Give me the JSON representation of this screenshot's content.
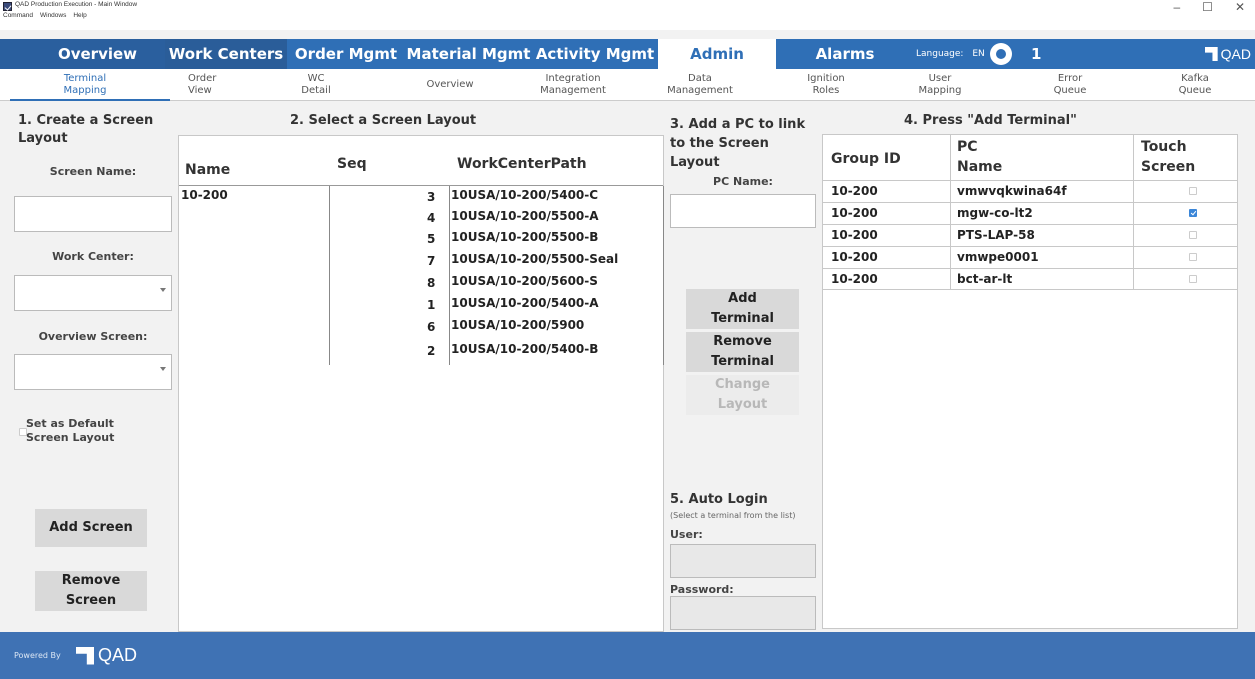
{
  "window": {
    "title": "QAD Production Execution - Main Window",
    "menu": [
      "Command",
      "Windows",
      "Help"
    ],
    "controls": [
      "–",
      "☐",
      "✕"
    ]
  },
  "topnav": {
    "tabs": [
      "Overview",
      "Work Centers",
      "Order Mgmt",
      "Material Mgmt",
      "Activity Mgmt",
      "Admin",
      "Alarms"
    ],
    "active": "Admin",
    "language_label": "Language:",
    "language_value": "EN",
    "alarm_count": "1",
    "logo": "QAD"
  },
  "subnav": {
    "items": [
      {
        "line1": "Terminal",
        "line2": "Mapping"
      },
      {
        "line1": "Order",
        "line2": "View"
      },
      {
        "line1": "WC",
        "line2": "Detail"
      },
      {
        "line1": "Overview",
        "line2": ""
      },
      {
        "line1": "Integration",
        "line2": "Management"
      },
      {
        "line1": "Data",
        "line2": "Management"
      },
      {
        "line1": "Ignition",
        "line2": "Roles"
      },
      {
        "line1": "User",
        "line2": "Mapping"
      },
      {
        "line1": "Error",
        "line2": "Queue"
      },
      {
        "line1": "Kafka",
        "line2": "Queue"
      }
    ],
    "active_index": 0
  },
  "section1": {
    "heading_line1": "1. Create a Screen",
    "heading_line2": "Layout",
    "screen_name_label": "Screen Name:",
    "screen_name_value": "",
    "work_center_label": "Work Center:",
    "work_center_value": "",
    "overview_screen_label": "Overview Screen:",
    "overview_screen_value": "",
    "default_label_line1": "Set as Default",
    "default_label_line2": "Screen Layout",
    "default_checked": false,
    "add_button": "Add Screen",
    "remove_button_line1": "Remove",
    "remove_button_line2": "Screen"
  },
  "section2": {
    "heading": "2. Select a Screen Layout",
    "columns": [
      "Name",
      "Seq",
      "WorkCenterPath"
    ],
    "name": "10-200",
    "rows": [
      {
        "seq": "3",
        "path": "10USA/10-200/5400-C"
      },
      {
        "seq": "4",
        "path": "10USA/10-200/5500-A"
      },
      {
        "seq": "5",
        "path": "10USA/10-200/5500-B"
      },
      {
        "seq": "7",
        "path": "10USA/10-200/5500-Seal"
      },
      {
        "seq": "8",
        "path": "10USA/10-200/5600-S"
      },
      {
        "seq": "1",
        "path": "10USA/10-200/5400-A"
      },
      {
        "seq": "6",
        "path": "10USA/10-200/5900"
      },
      {
        "seq": "2",
        "path": "10USA/10-200/5400-B"
      }
    ]
  },
  "section3": {
    "heading_line1": "3. Add a PC to link",
    "heading_line2": "to the Screen",
    "heading_line3": "Layout",
    "pc_name_label": "PC Name:",
    "pc_name_value": "",
    "add_terminal_line1": "Add",
    "add_terminal_line2": "Terminal",
    "remove_terminal_line1": "Remove",
    "remove_terminal_line2": "Terminal",
    "change_layout_line1": "Change",
    "change_layout_line2": "Layout"
  },
  "section5": {
    "heading": "5. Auto Login",
    "hint": "(Select a terminal from the list)",
    "user_label": "User:",
    "user_value": "",
    "password_label": "Password:",
    "password_value": ""
  },
  "section4": {
    "heading": "4. Press \"Add Terminal\"",
    "columns": {
      "group_id": "Group ID",
      "pc_line1": "PC",
      "pc_line2": "Name",
      "touch_line1": "Touch",
      "touch_line2": "Screen"
    },
    "rows": [
      {
        "group": "10-200",
        "pc": "vmwvqkwina64f",
        "touch": false
      },
      {
        "group": "10-200",
        "pc": "mgw-co-lt2",
        "touch": true
      },
      {
        "group": "10-200",
        "pc": "PTS-LAP-58",
        "touch": false
      },
      {
        "group": "10-200",
        "pc": "vmwpe0001",
        "touch": false
      },
      {
        "group": "10-200",
        "pc": "bct-ar-lt",
        "touch": false
      }
    ]
  },
  "footer": {
    "powered_by": "Powered By",
    "logo": "QAD"
  }
}
